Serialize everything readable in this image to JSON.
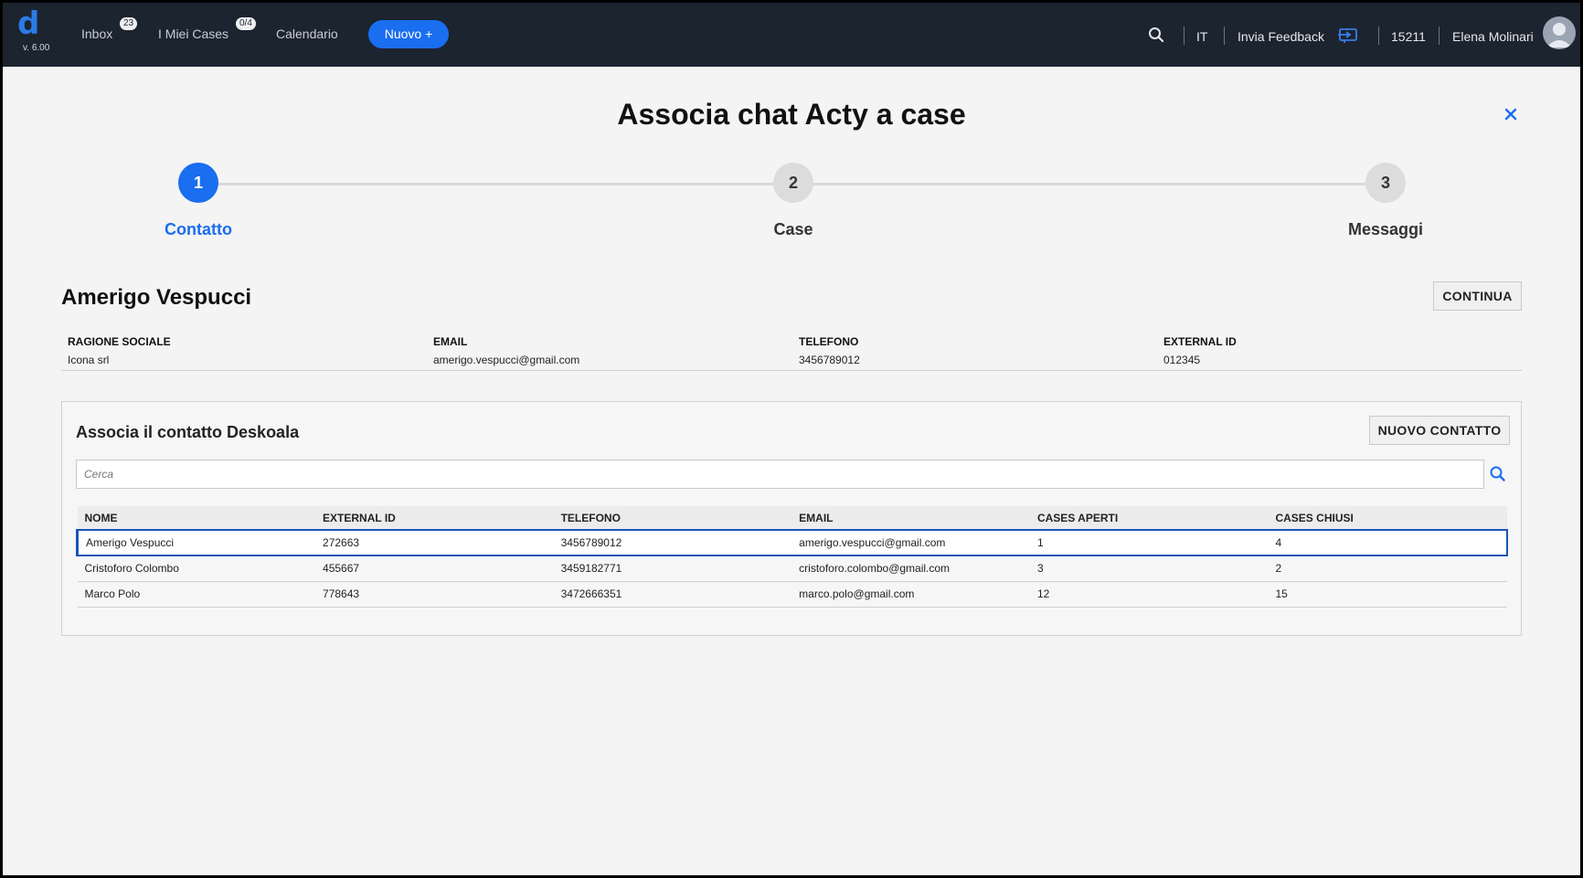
{
  "app": {
    "logo_letter": "d",
    "version": "v. 6.00"
  },
  "nav": {
    "inbox_label": "Inbox",
    "inbox_badge": "23",
    "my_cases_label": "I Miei Cases",
    "my_cases_badge": "0/4",
    "calendar_label": "Calendario",
    "new_button_label": "Nuovo +"
  },
  "header_right": {
    "search_icon": "search-icon",
    "language": "IT",
    "feedback_label": "Invia Feedback",
    "feedback_icon": "feedback-icon",
    "user_code": "15211",
    "user_name": "Elena Molinari"
  },
  "page": {
    "title": "Associa chat Acty a case",
    "close_icon": "close-icon"
  },
  "stepper": {
    "steps": [
      {
        "number": "1",
        "label": "Contatto",
        "state": "active"
      },
      {
        "number": "2",
        "label": "Case",
        "state": "idle"
      },
      {
        "number": "3",
        "label": "Messaggi",
        "state": "idle"
      }
    ]
  },
  "contact": {
    "name": "Amerigo Vespucci",
    "continue_label": "CONTINUA",
    "fields": [
      {
        "label": "RAGIONE SOCIALE",
        "value": "Icona srl"
      },
      {
        "label": "EMAIL",
        "value": "amerigo.vespucci@gmail.com"
      },
      {
        "label": "TELEFONO",
        "value": "3456789012"
      },
      {
        "label": "EXTERNAL ID",
        "value": "012345"
      }
    ]
  },
  "associate_panel": {
    "title": "Associa il contatto Deskoala",
    "new_contact_label": "NUOVO CONTATTO",
    "search_placeholder": "Cerca",
    "columns": [
      "NOME",
      "EXTERNAL ID",
      "TELEFONO",
      "EMAIL",
      "CASES APERTI",
      "CASES CHIUSI"
    ],
    "rows": [
      {
        "nome": "Amerigo Vespucci",
        "external_id": "272663",
        "telefono": "3456789012",
        "email": "amerigo.vespucci@gmail.com",
        "cases_aperti": "1",
        "cases_chiusi": "4",
        "selected": true
      },
      {
        "nome": "Cristoforo Colombo",
        "external_id": "455667",
        "telefono": "3459182771",
        "email": "cristoforo.colombo@gmail.com",
        "cases_aperti": "3",
        "cases_chiusi": "2",
        "selected": false
      },
      {
        "nome": "Marco Polo",
        "external_id": "778643",
        "telefono": "3472666351",
        "email": "marco.polo@gmail.com",
        "cases_aperti": "12",
        "cases_chiusi": "15",
        "selected": false
      }
    ]
  },
  "colors": {
    "topbar": "#1c2430",
    "accent": "#1a6ef0",
    "selected_border": "#1a55b8"
  }
}
